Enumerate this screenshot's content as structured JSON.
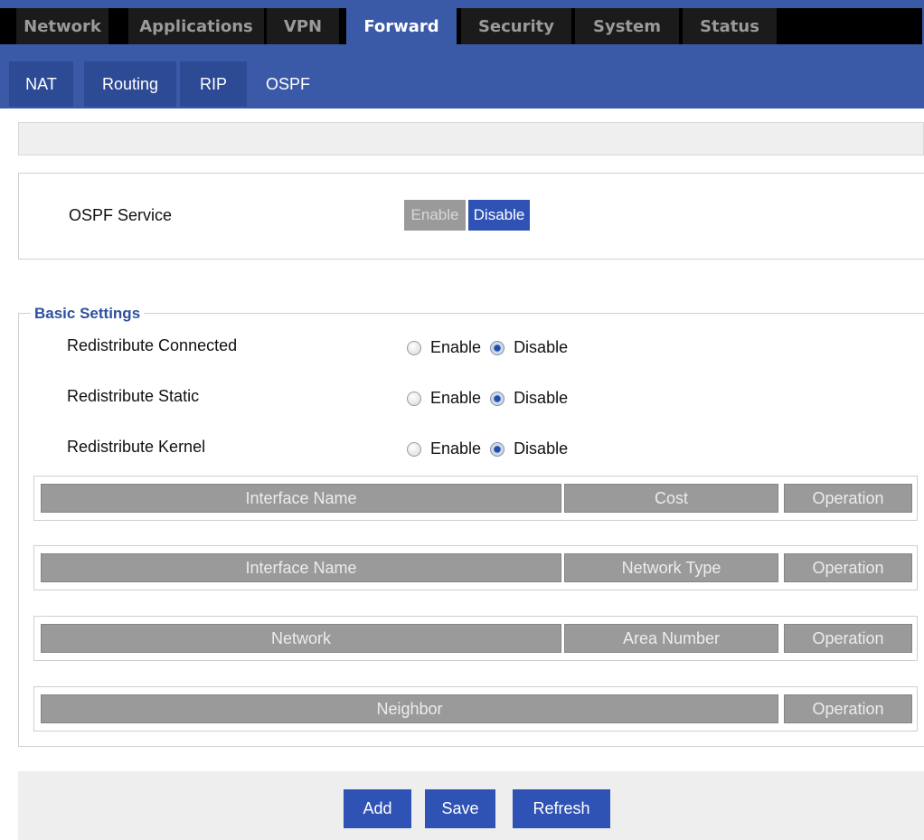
{
  "top_nav": {
    "tabs": [
      {
        "label": "Network"
      },
      {
        "label": "Applications"
      },
      {
        "label": "VPN"
      },
      {
        "label": "Forward",
        "active": true
      },
      {
        "label": "Security"
      },
      {
        "label": "System"
      },
      {
        "label": "Status"
      }
    ]
  },
  "sub_nav": {
    "tabs": [
      {
        "label": "NAT"
      },
      {
        "label": "Routing"
      },
      {
        "label": "RIP"
      },
      {
        "label": "OSPF",
        "active": true
      }
    ]
  },
  "ospf_service": {
    "label": "OSPF Service",
    "enable_label": "Enable",
    "disable_label": "Disable",
    "selected": "Disable"
  },
  "basic_settings": {
    "title": "Basic Settings",
    "rows": [
      {
        "label": "Redistribute Connected",
        "enable": "Enable",
        "disable": "Disable",
        "selected": "Disable"
      },
      {
        "label": "Redistribute Static",
        "enable": "Enable",
        "disable": "Disable",
        "selected": "Disable"
      },
      {
        "label": "Redistribute Kernel",
        "enable": "Enable",
        "disable": "Disable",
        "selected": "Disable"
      }
    ]
  },
  "tables": [
    {
      "columns": [
        "Interface Name",
        "Cost",
        "Operation"
      ]
    },
    {
      "columns": [
        "Interface Name",
        "Network Type",
        "Operation"
      ]
    },
    {
      "columns": [
        "Network",
        "Area Number",
        "Operation"
      ]
    },
    {
      "columns": [
        "Neighbor",
        "Operation"
      ]
    }
  ],
  "footer": {
    "add_label": "Add",
    "save_label": "Save",
    "refresh_label": "Refresh"
  },
  "colors": {
    "nav_dark": "#1b1b1b",
    "accent_blue": "#3a5aa8",
    "button_blue": "#2f52b5",
    "header_gray": "#9a9a9a"
  }
}
